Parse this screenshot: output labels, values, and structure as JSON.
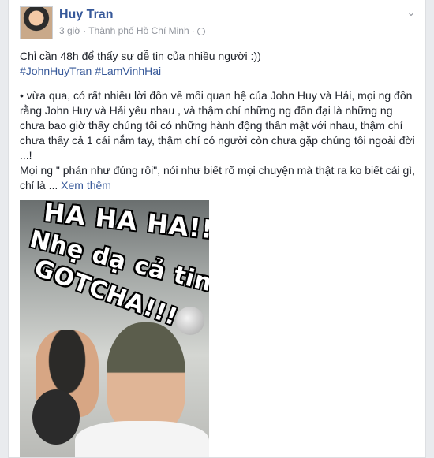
{
  "post": {
    "author": "Huy Tran",
    "time": "3 giờ",
    "separator": "·",
    "location": "Thành phố Hồ Chí Minh",
    "privacy_sep": "·",
    "headline": "Chỉ cần 48h để thấy sự dễ tin của nhiều người :))",
    "hashtags": [
      "#JohnHuyTran",
      "#LamVinhHai"
    ],
    "paragraph": "• vừa qua, có rất nhiều lời đồn về mối quan hệ của John Huy và Hải, mọi ng đồn rằng John Huy và Hải yêu nhau , và thậm chí những ng đồn đại là những ng chưa bao giờ thấy chúng tôi có những hành động thân mật với nhau, thậm chí chưa thấy cả 1 cái nắm tay, thậm chí có người còn chưa gặp chúng tôi ngoài đời ...!",
    "paragraph2": "Mọi ng \" phán như đúng rồi\", nói như biết rõ mọi chuyện mà thật ra ko biết cái gì, chỉ là ...",
    "see_more": "Xem thêm"
  },
  "photo": {
    "caption_line1": "HA HA HA!!!",
    "caption_line2": "Nhẹ dạ cả tin",
    "caption_line3": "GOTCHA!!!"
  },
  "icons": {
    "globe": "globe-icon",
    "menu": "chevron-down-icon"
  },
  "colors": {
    "link": "#365899",
    "text": "#1d2129",
    "meta": "#90949c"
  }
}
